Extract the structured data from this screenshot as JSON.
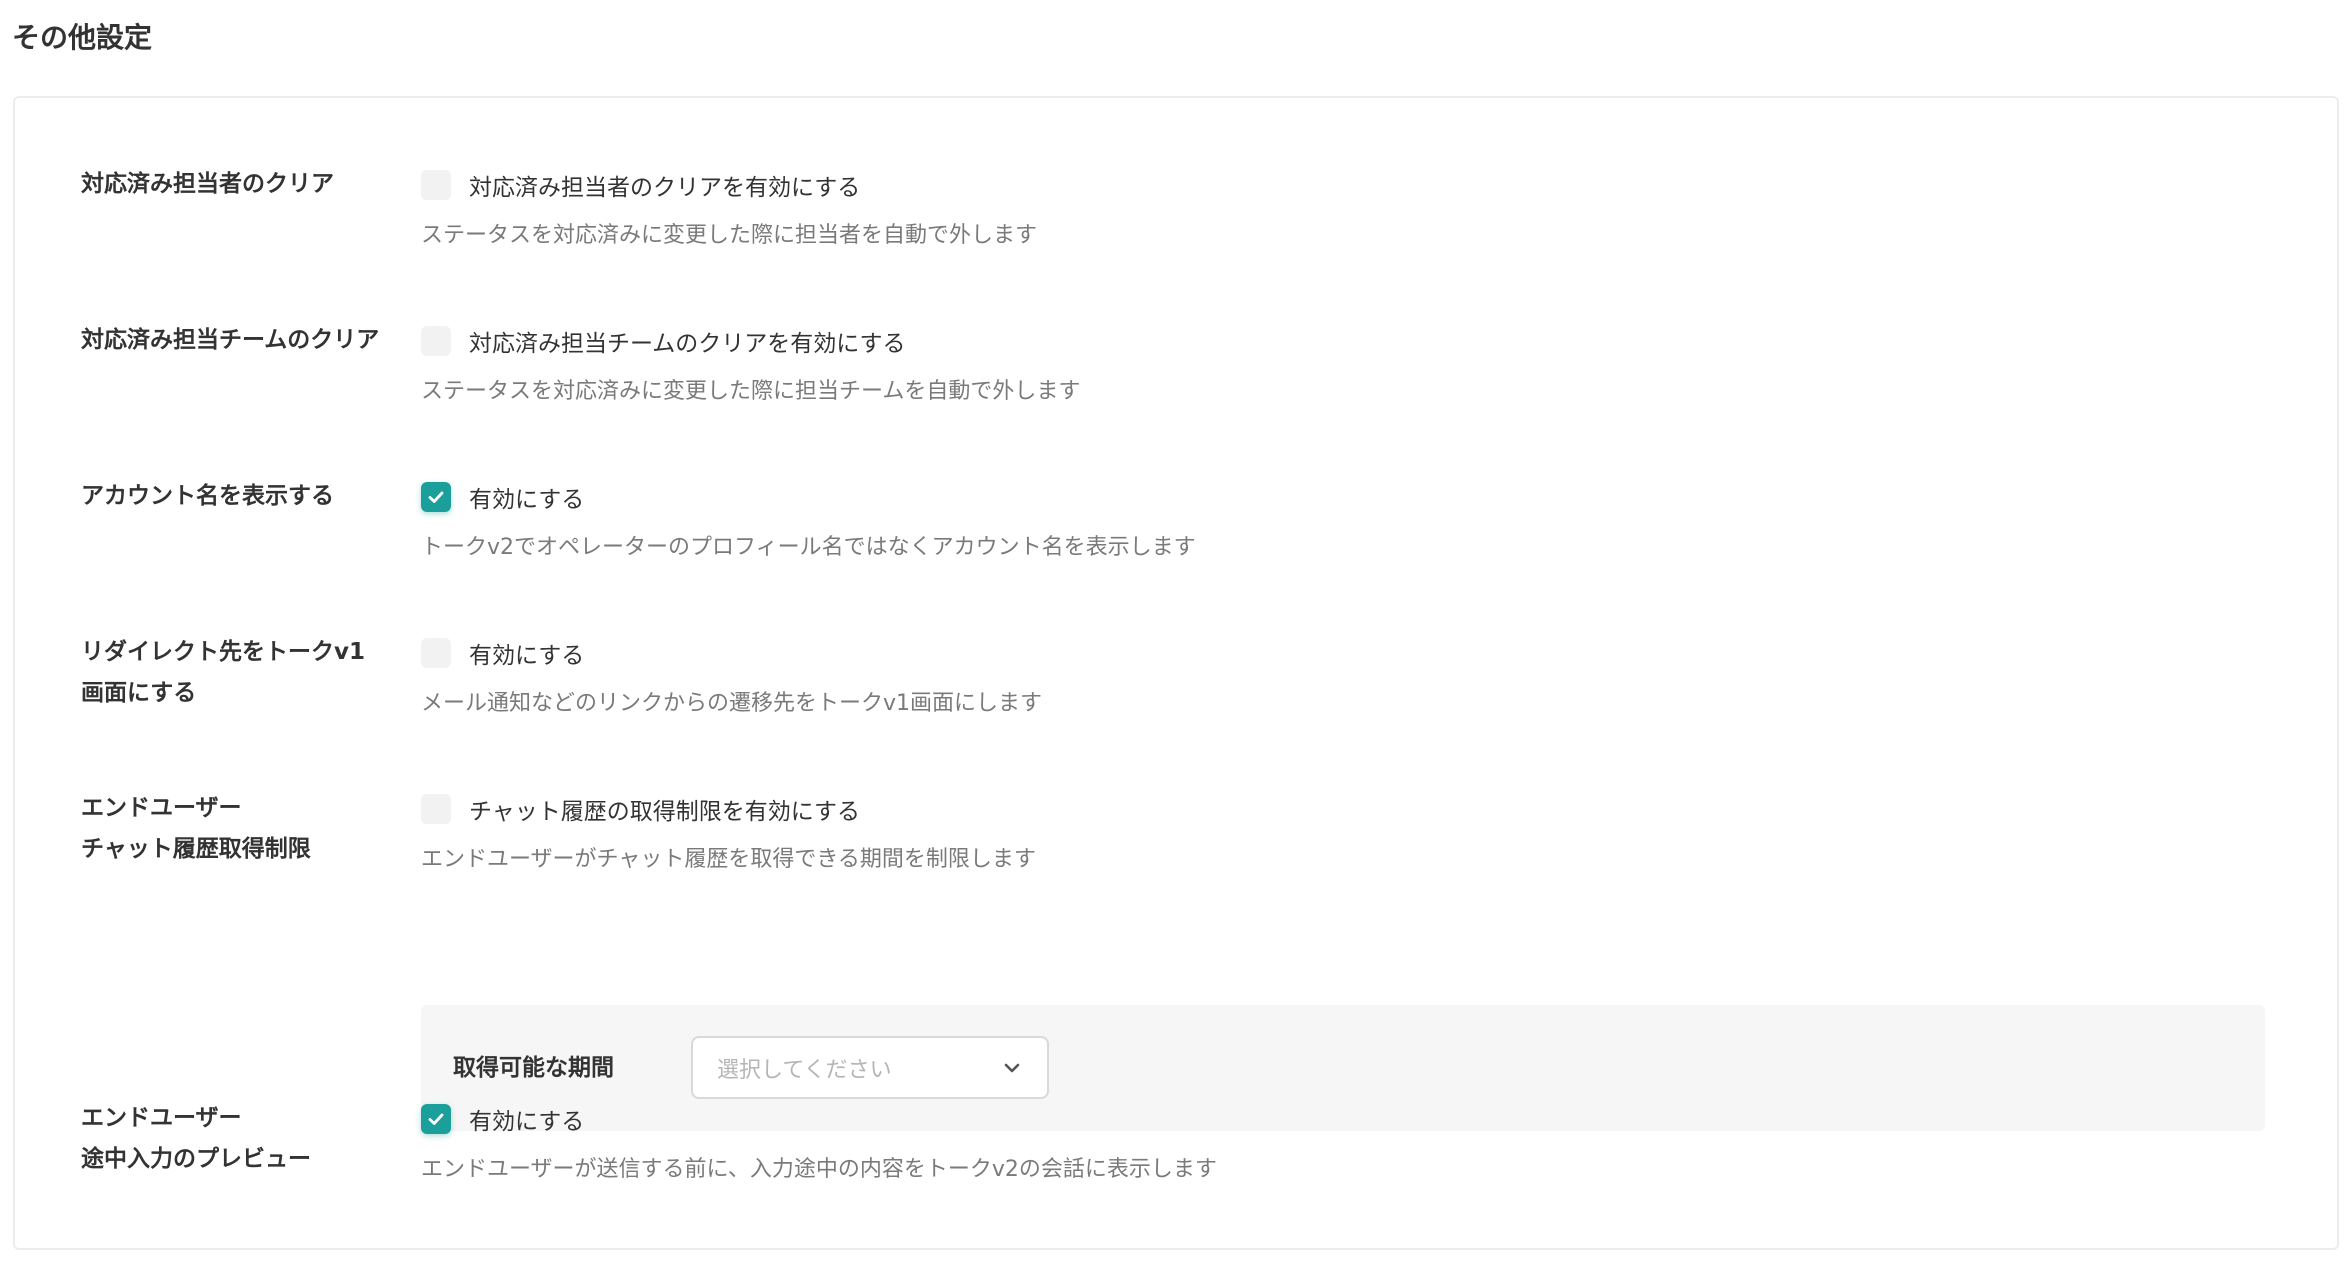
{
  "page": {
    "title": "その他設定"
  },
  "settings": [
    {
      "label": "対応済み担当者のクリア",
      "checkbox_label": "対応済み担当者のクリアを有効にする",
      "checked": false,
      "description": "ステータスを対応済みに変更した際に担当者を自動で外します"
    },
    {
      "label": "対応済み担当チームのクリア",
      "checkbox_label": "対応済み担当チームのクリアを有効にする",
      "checked": false,
      "description": "ステータスを対応済みに変更した際に担当チームを自動で外します"
    },
    {
      "label": "アカウント名を表示する",
      "checkbox_label": "有効にする",
      "checked": true,
      "description": "トークv2でオペレーターのプロフィール名ではなくアカウント名を表示します"
    },
    {
      "label": "リダイレクト先をトークv1\n画面にする",
      "checkbox_label": "有効にする",
      "checked": false,
      "description": "メール通知などのリンクからの遷移先をトークv1画面にします"
    },
    {
      "label": "エンドユーザー\nチャット履歴取得制限",
      "checkbox_label": "チャット履歴の取得制限を有効にする",
      "checked": false,
      "description": "エンドユーザーがチャット履歴を取得できる期間を制限します"
    },
    {
      "label": "エンドユーザー\n途中入力のプレビュー",
      "checkbox_label": "有効にする",
      "checked": true,
      "description": "エンドユーザーが送信する前に、入力途中の内容をトークv2の会話に表示します"
    }
  ],
  "period": {
    "label": "取得可能な期間",
    "placeholder": "選択してください"
  },
  "colors": {
    "accent": "#1a9f9a",
    "unchecked": "#f2f2f2",
    "panel": "#f6f6f6"
  }
}
